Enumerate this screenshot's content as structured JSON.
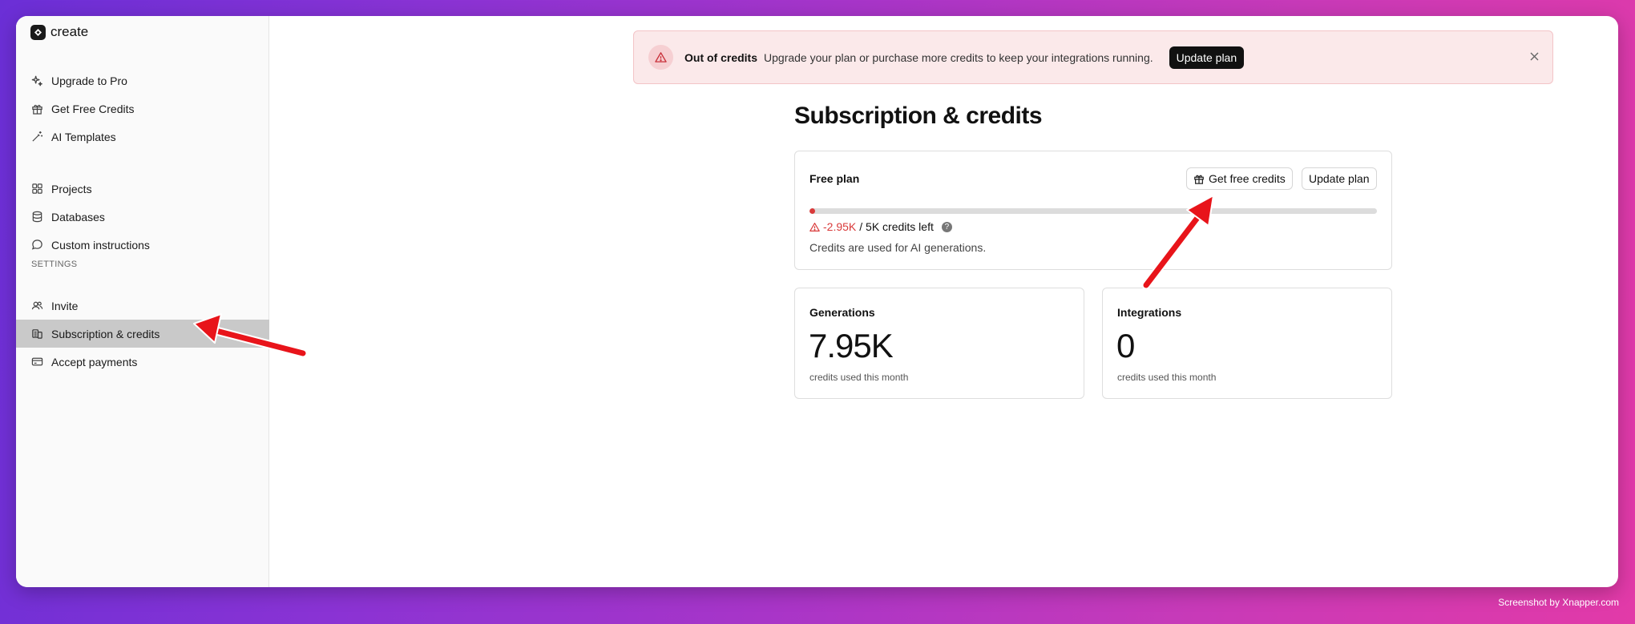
{
  "app": {
    "brand": "create"
  },
  "sidebar": {
    "top_items": [
      {
        "label": "Upgrade to Pro",
        "icon": "sparkle-icon"
      },
      {
        "label": "Get Free Credits",
        "icon": "gift-icon"
      },
      {
        "label": "AI Templates",
        "icon": "wand-icon"
      }
    ],
    "mid_items": [
      {
        "label": "Projects",
        "icon": "grid-icon"
      },
      {
        "label": "Databases",
        "icon": "database-icon"
      },
      {
        "label": "Custom instructions",
        "icon": "chat-icon"
      }
    ],
    "settings_label": "SETTINGS",
    "settings_items": [
      {
        "label": "Invite",
        "icon": "users-icon"
      },
      {
        "label": "Subscription & credits",
        "icon": "coins-icon",
        "active": true
      },
      {
        "label": "Accept payments",
        "icon": "card-icon"
      }
    ]
  },
  "banner": {
    "title": "Out of credits",
    "message": "Upgrade your plan or purchase more credits to keep your integrations running.",
    "button": "Update plan"
  },
  "page": {
    "title": "Subscription & credits"
  },
  "plan": {
    "name": "Free plan",
    "get_credits_button": "Get free credits",
    "update_button": "Update plan",
    "credits_left": "-2.95K",
    "credits_total": "/ 5K credits left",
    "progress_fraction": 0,
    "note": "Credits are used for AI generations."
  },
  "stats": [
    {
      "title": "Generations",
      "value": "7.95K",
      "sub": "credits used this month"
    },
    {
      "title": "Integrations",
      "value": "0",
      "sub": "credits used this month"
    }
  ],
  "footer": {
    "credit": "Screenshot by Xnapper.com"
  },
  "colors": {
    "accent": "#111111",
    "danger": "#d93a3a",
    "annotation_arrow": "#ff0000"
  }
}
